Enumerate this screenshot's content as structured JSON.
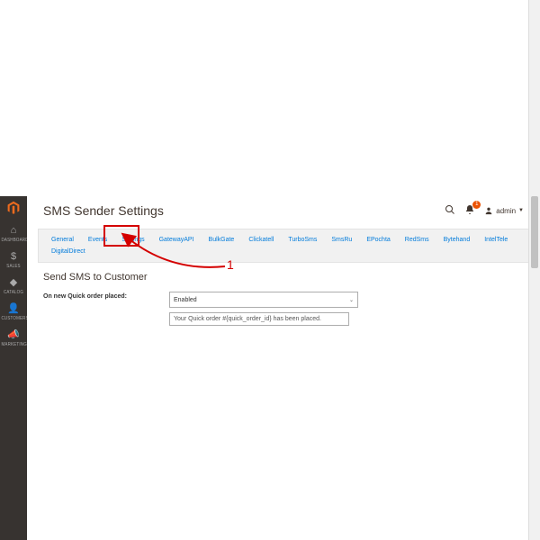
{
  "sidebar": {
    "items": [
      {
        "icon": "⌂",
        "label": "DASHBOARD"
      },
      {
        "icon": "$",
        "label": "SALES"
      },
      {
        "icon": "◆",
        "label": "CATALOG"
      },
      {
        "icon": "👤",
        "label": "CUSTOMERS"
      },
      {
        "icon": "📣",
        "label": "MARKETING"
      }
    ]
  },
  "header": {
    "title": "SMS Sender Settings",
    "notification_count": "1",
    "user_label": "admin"
  },
  "tabs": [
    {
      "label": "General"
    },
    {
      "label": "Events",
      "active": true
    },
    {
      "label": "Settings"
    },
    {
      "label": "GatewayAPI"
    },
    {
      "label": "BulkGate"
    },
    {
      "label": "Clickatell"
    },
    {
      "label": "TurboSms"
    },
    {
      "label": "SmsRu"
    },
    {
      "label": "EPochta"
    },
    {
      "label": "RedSms"
    },
    {
      "label": "Bytehand"
    },
    {
      "label": "IntelTele"
    },
    {
      "label": "DigitalDirect"
    }
  ],
  "section": {
    "title": "Send SMS to Customer",
    "row_label": "On new Quick order placed:",
    "select_value": "Enabled",
    "textarea_value": "Your Quick order #{quick_order_id} has been placed."
  },
  "annotation": {
    "number": "1"
  }
}
